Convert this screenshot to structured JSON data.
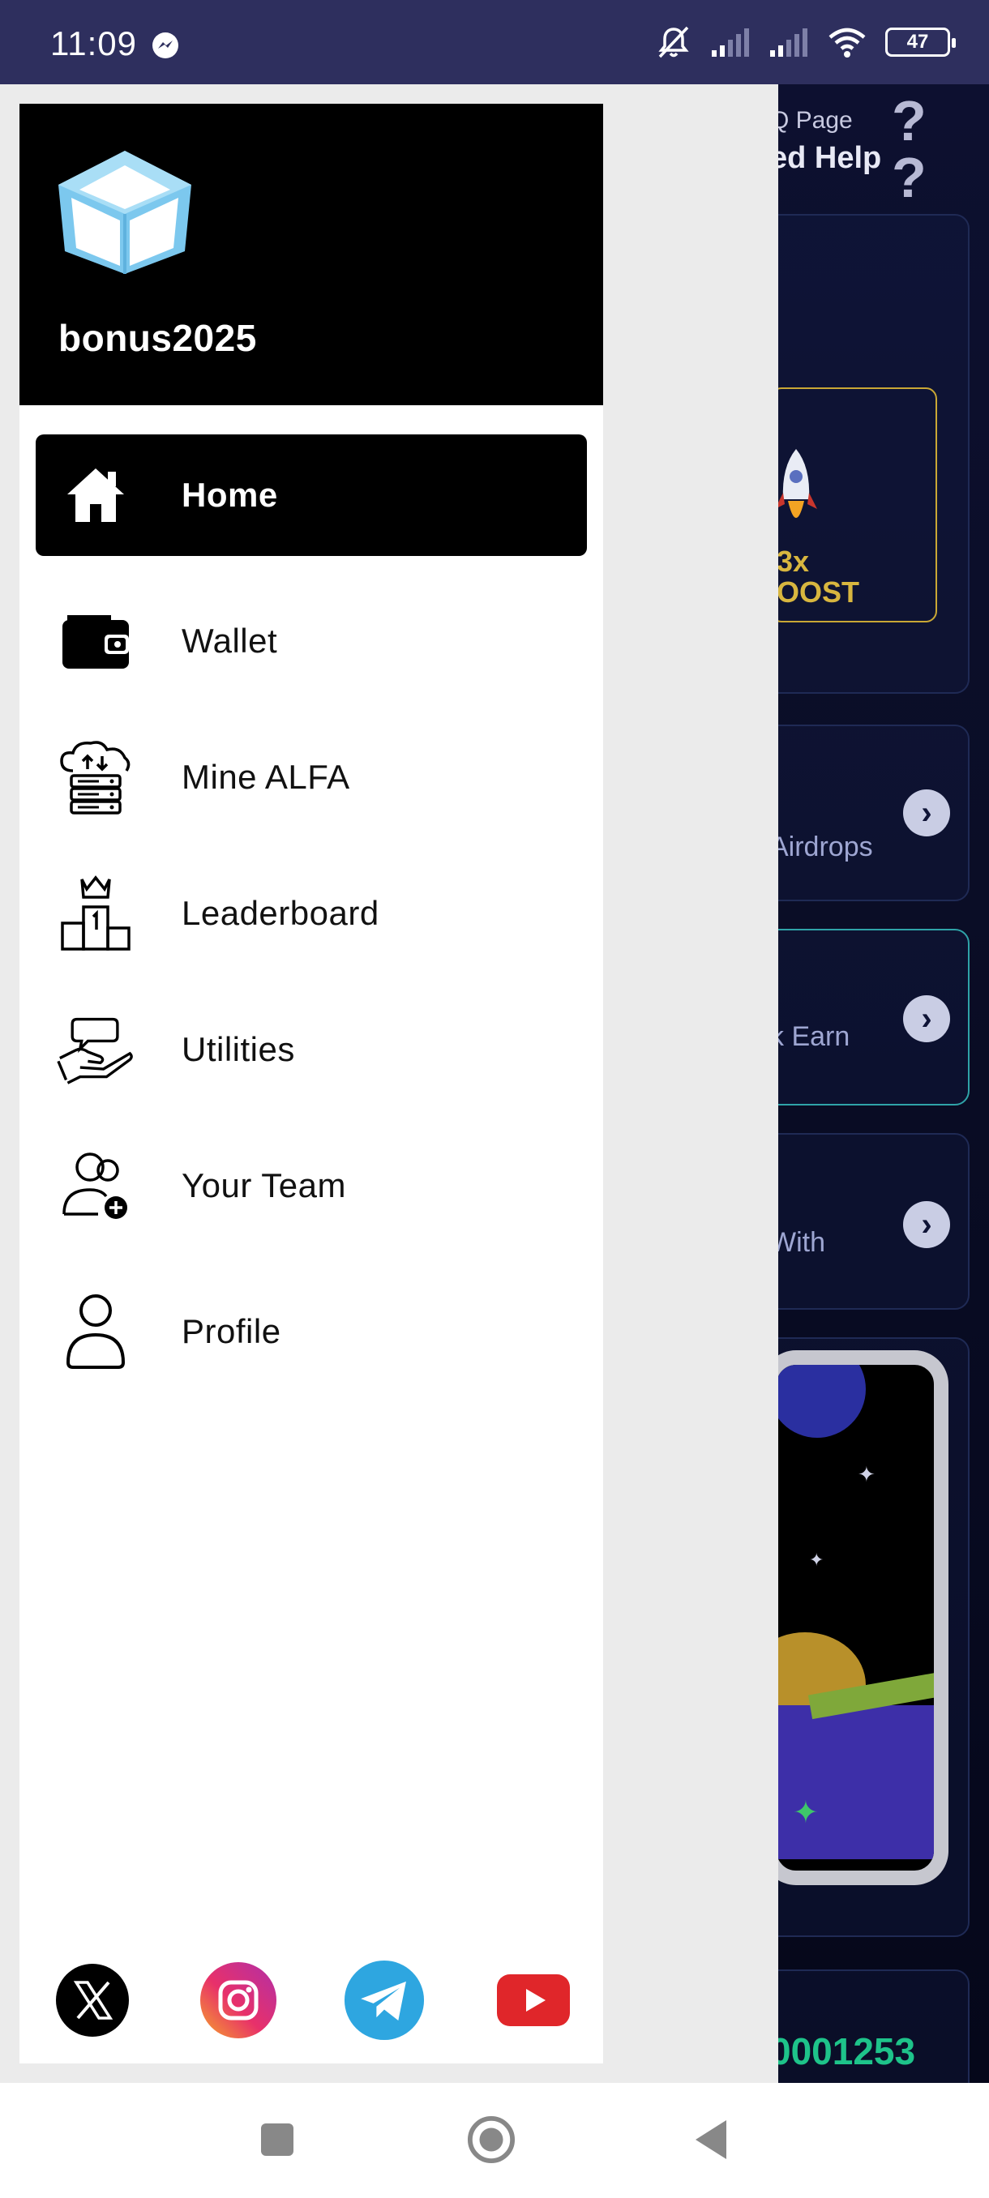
{
  "status_bar": {
    "time": "11:09",
    "battery": "47",
    "icons": [
      "messenger-icon",
      "silent-icon",
      "signal-icon",
      "signal-icon",
      "wifi-icon",
      "battery-icon"
    ]
  },
  "background_app": {
    "faq_small": "Q Page",
    "faq_big": "ed Help",
    "boost_line1": "3x",
    "boost_line2": "OOST",
    "card1_label": "Airdrops",
    "card2_label": "k Earn",
    "card3_label": "With",
    "code": "0001253"
  },
  "drawer": {
    "username": "bonus2025",
    "logo": "cube-logo",
    "menu": [
      {
        "label": "Home",
        "icon": "home-icon",
        "active": true
      },
      {
        "label": "Wallet",
        "icon": "wallet-icon",
        "active": false
      },
      {
        "label": "Mine ALFA",
        "icon": "cloud-server-icon",
        "active": false
      },
      {
        "label": "Leaderboard",
        "icon": "podium-crown-icon",
        "active": false
      },
      {
        "label": "Utilities",
        "icon": "hand-chat-icon",
        "active": false
      },
      {
        "label": "Your Team",
        "icon": "add-user-icon",
        "active": false
      },
      {
        "label": "Profile",
        "icon": "user-icon",
        "active": false
      }
    ],
    "socials": [
      "x-icon",
      "instagram-icon",
      "telegram-icon",
      "youtube-icon"
    ]
  },
  "colors": {
    "status_bar_bg": "#2e2f5e",
    "drawer_header_bg": "#000000",
    "active_item_bg": "#000000",
    "background_app": "#0a0d26",
    "accent_green": "#1ec38a",
    "boost_gold": "#d8b63f"
  }
}
